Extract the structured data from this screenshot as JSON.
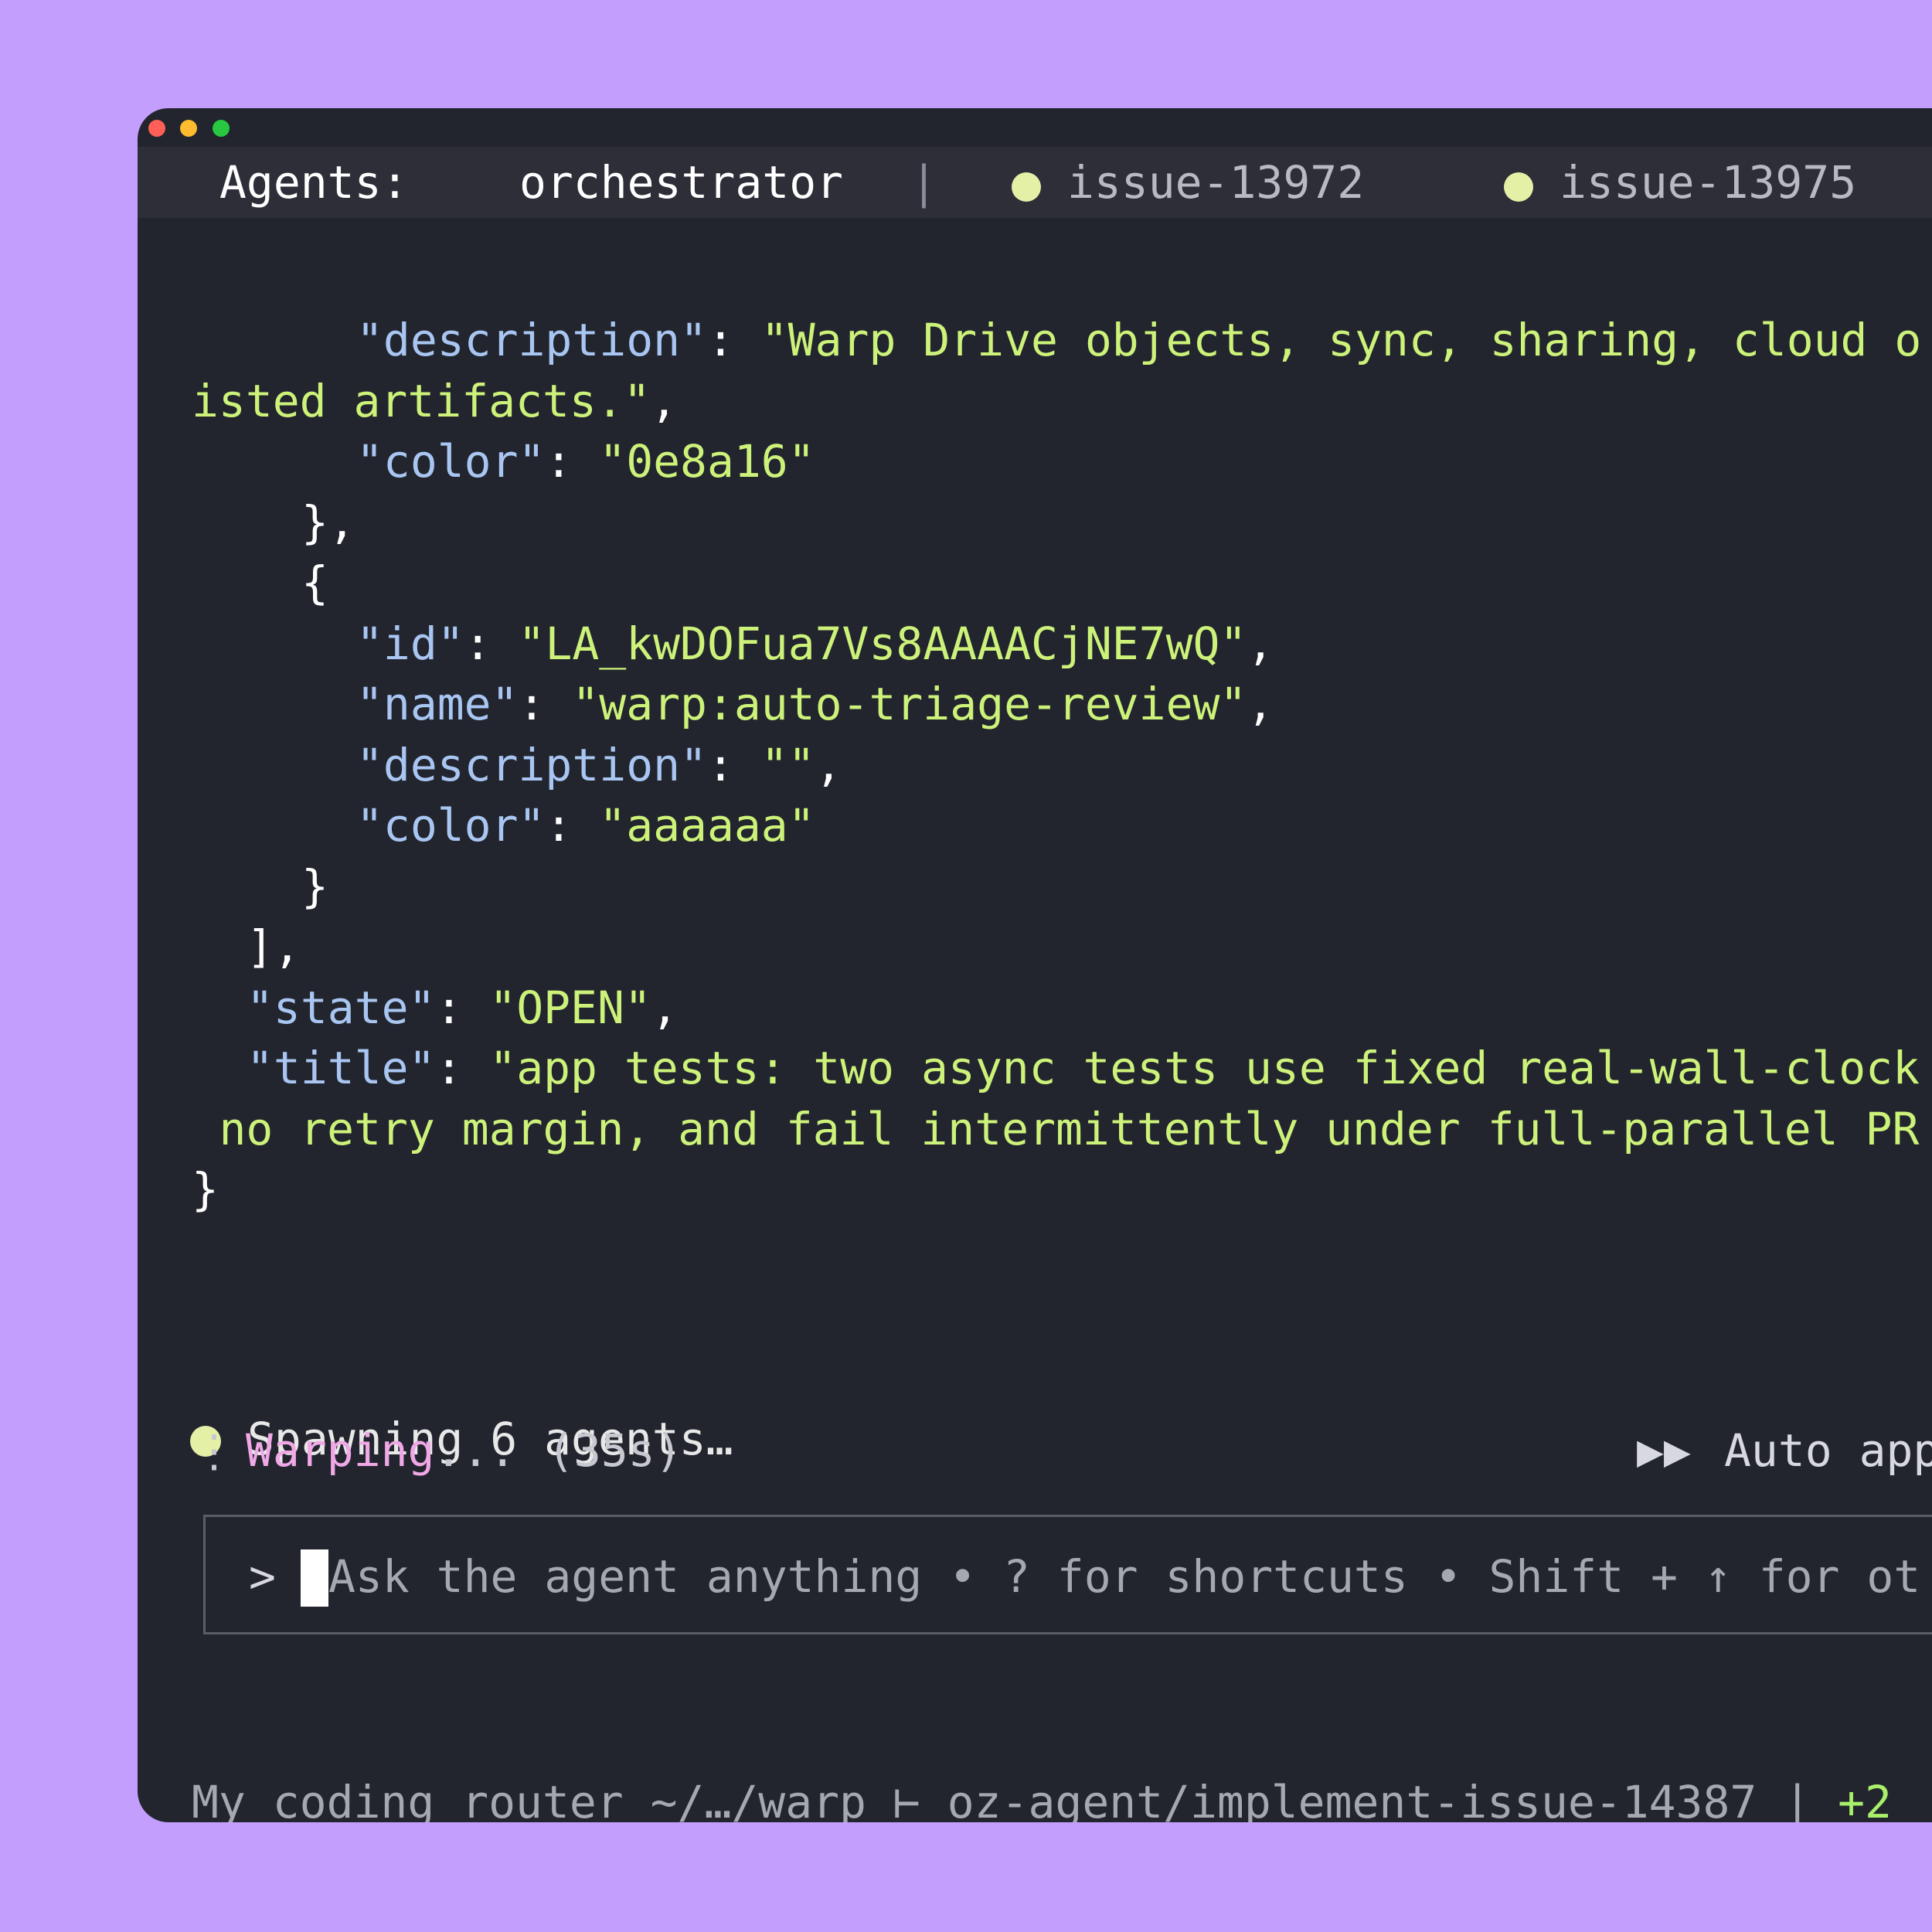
{
  "window": {
    "traffic_lights": [
      {
        "name": "close",
        "color": "#ff5f57"
      },
      {
        "name": "minimize",
        "color": "#febc2e"
      },
      {
        "name": "zoom",
        "color": "#28c840"
      }
    ]
  },
  "tabs": {
    "label": "Agents:",
    "active": "orchestrator",
    "separator": "|",
    "items": [
      {
        "label": "issue-13972",
        "dot_color": "#e4f0a6"
      },
      {
        "label": "issue-13975",
        "dot_color": "#e4f0a6"
      }
    ]
  },
  "code_lines": [
    {
      "indent": 6,
      "key": "\"description\"",
      "punct": ": ",
      "value": "\"Warp Drive objects, sync, sharing, cloud o",
      "tail": ""
    },
    {
      "indent": 0,
      "key": "",
      "punct": "",
      "value": "isted artifacts.\"",
      "tail": ","
    },
    {
      "indent": 6,
      "key": "\"color\"",
      "punct": ": ",
      "value": "\"0e8a16\"",
      "tail": ""
    },
    {
      "indent": 4,
      "key": "",
      "punct": "},",
      "value": "",
      "tail": ""
    },
    {
      "indent": 4,
      "key": "",
      "punct": "{",
      "value": "",
      "tail": ""
    },
    {
      "indent": 6,
      "key": "\"id\"",
      "punct": ": ",
      "value": "\"LA_kwDOFua7Vs8AAAACjNE7wQ\"",
      "tail": ","
    },
    {
      "indent": 6,
      "key": "\"name\"",
      "punct": ": ",
      "value": "\"warp:auto-triage-review\"",
      "tail": ","
    },
    {
      "indent": 6,
      "key": "\"description\"",
      "punct": ": ",
      "value": "\"\"",
      "tail": ","
    },
    {
      "indent": 6,
      "key": "\"color\"",
      "punct": ": ",
      "value": "\"aaaaaa\"",
      "tail": ""
    },
    {
      "indent": 4,
      "key": "",
      "punct": "}",
      "value": "",
      "tail": ""
    },
    {
      "indent": 2,
      "key": "",
      "punct": "],",
      "value": "",
      "tail": ""
    },
    {
      "indent": 2,
      "key": "\"state\"",
      "punct": ": ",
      "value": "\"OPEN\"",
      "tail": ","
    },
    {
      "indent": 2,
      "key": "\"title\"",
      "punct": ": ",
      "value": "\"app tests: two async tests use fixed real-wall-clock",
      "tail": ""
    },
    {
      "indent": 1,
      "key": "",
      "punct": "",
      "value": "no retry margin, and fail intermittently under full-parallel PR",
      "tail": ""
    },
    {
      "indent": 0,
      "key": "",
      "punct": "}",
      "value": "",
      "tail": ""
    }
  ],
  "status": {
    "dot_color": "#e4f0a6",
    "text": "Spawning 6 agents…"
  },
  "warping": {
    "menu_icon": "vertical-ellipsis-icon",
    "label": "Warping",
    "dots": "...",
    "elapsed": "(35s)",
    "auto_icon": "fast-forward-icon",
    "auto_label": "Auto app"
  },
  "input": {
    "prompt": ">",
    "placeholder": "Ask the agent anything • ? for shortcuts • Shift + ↑ for ot"
  },
  "footer": {
    "text": "My coding router ~/…/warp ⊢ oz-agent/implement-issue-14387 | ",
    "diff": "+2"
  }
}
